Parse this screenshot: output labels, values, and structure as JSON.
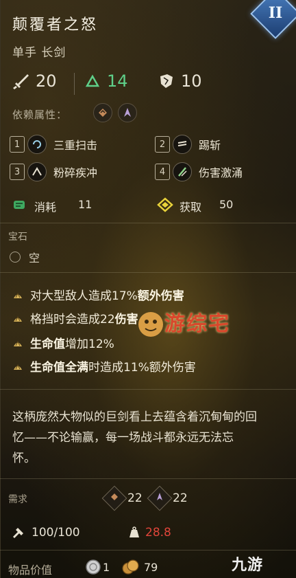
{
  "item": {
    "name": "颠覆者之怒",
    "type": "单手 长剑",
    "tier": "II"
  },
  "stats": {
    "attack": "20",
    "stagger": "14",
    "secondary": "10"
  },
  "dependency": {
    "label": "依赖属性："
  },
  "skills": [
    {
      "num": "1",
      "name": "三重扫击"
    },
    {
      "num": "2",
      "name": "踢斩"
    },
    {
      "num": "3",
      "name": "粉碎疾冲"
    },
    {
      "num": "4",
      "name": "伤害激涌"
    }
  ],
  "cost": {
    "consume_label": "消耗",
    "consume_value": "11",
    "gain_label": "获取",
    "gain_value": "50"
  },
  "gem": {
    "title": "宝石",
    "slot": "空"
  },
  "perks": [
    {
      "pre": "对大型敌人造成17%",
      "bold": "额外伤害",
      "post": ""
    },
    {
      "pre": "格挡时会造成22",
      "bold": "伤害",
      "post": ""
    },
    {
      "pre": "",
      "bold": "生命值",
      "post": "增加12%"
    },
    {
      "pre": "",
      "bold": "生命值全满",
      "post": "时造成11%额外伤害"
    }
  ],
  "description": {
    "line1": "这柄庞然大物似的巨剑看上去蕴含着沉甸甸的回",
    "line2": "忆——不论输赢，每一场战斗都永远无法忘",
    "line3": "怀。"
  },
  "requirements": {
    "label": "需求",
    "str": "22",
    "dex": "22"
  },
  "durability": {
    "value": "100/100",
    "weight": "28.8"
  },
  "value": {
    "label": "物品价值",
    "coins_small": "1",
    "coins_large": "79"
  },
  "watermarks": {
    "site1": "游综宅",
    "site2": "九游"
  },
  "colors": {
    "tier_badge": "#2c5fa0",
    "stagger_green": "#5fd08a",
    "weight_red": "#e0453a",
    "perk_gold": "#d8b45a"
  }
}
